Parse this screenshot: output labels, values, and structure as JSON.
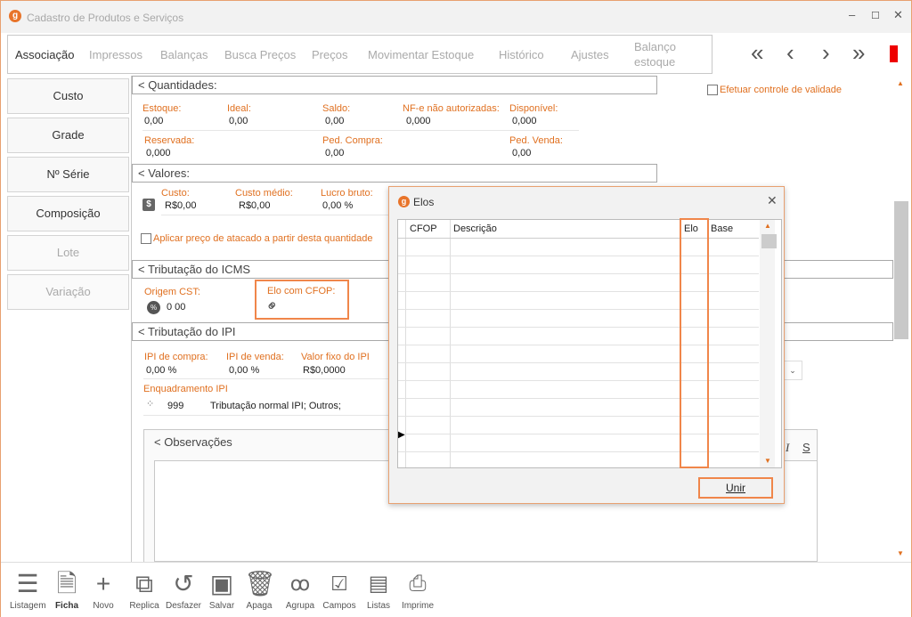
{
  "window": {
    "title": "Cadastro de Produtos e Serviços",
    "min": "–",
    "max": "☐",
    "close": "✕"
  },
  "tabs": [
    {
      "label": "Associação"
    },
    {
      "label": "Impressos"
    },
    {
      "label": "Balanças"
    },
    {
      "label": "Busca Preços"
    },
    {
      "label": "Preços"
    },
    {
      "label": "Movimentar Estoque"
    },
    {
      "label": "Histórico"
    },
    {
      "label": "Ajustes"
    },
    {
      "label": "Balanço estoque"
    }
  ],
  "nav": {
    "first": "«",
    "prev": "‹",
    "next": "›",
    "last": "»"
  },
  "sidebar": [
    {
      "label": "Custo"
    },
    {
      "label": "Grade"
    },
    {
      "label": "Nº Série"
    },
    {
      "label": "Composição"
    },
    {
      "label": "Lote"
    },
    {
      "label": "Variação"
    }
  ],
  "validade_label": "Efetuar controle de validade",
  "quantidades": {
    "title": "Quantidades:",
    "estoque_label": "Estoque:",
    "estoque": "0,00",
    "ideal_label": "Ideal:",
    "ideal": "0,00",
    "saldo_label": "Saldo:",
    "saldo": "0,00",
    "nfe_label": "NF-e não autorizadas:",
    "nfe": "0,000",
    "disponivel_label": "Disponível:",
    "disponivel": "0,000",
    "reservada_label": "Reservada:",
    "reservada": "0,000",
    "pedcompra_label": "Ped. Compra:",
    "pedcompra": "0,00",
    "pedvenda_label": "Ped. Venda:",
    "pedvenda": "0,00"
  },
  "valores": {
    "title": "Valores:",
    "custo_label": "Custo:",
    "custo": "R$0,00",
    "customedio_label": "Custo médio:",
    "customedio": "R$0,00",
    "lucro_label": "Lucro bruto:",
    "lucro": "0,00 %",
    "atacado_label": "Aplicar preço de atacado a partir desta quantidade"
  },
  "icms": {
    "title": "Tributação do ICMS",
    "origem_label": "Origem CST:",
    "origem": "0 00",
    "elo_label": "Elo com CFOP:"
  },
  "ipi": {
    "title": "Tributação do IPI",
    "compra_label": "IPI de compra:",
    "compra": "0,00 %",
    "venda_label": "IPI de venda:",
    "venda": "0,00 %",
    "fixo_label": "Valor fixo do IPI",
    "fixo": "R$0,0000",
    "enq_label": "Enquadramento IPI",
    "enq_code": "999",
    "enq_desc": "Tributação normal IPI; Outros;"
  },
  "observacoes": {
    "title": "Observações",
    "italic": "I",
    "strike": "S"
  },
  "dialog": {
    "title": "Elos",
    "close": "✕",
    "columns": [
      "CFOP",
      "Descrição",
      "Elo",
      "Base"
    ],
    "button": "Unir"
  },
  "toolbar": [
    {
      "label": "Listagem",
      "icon": "list-icon"
    },
    {
      "label": "Ficha",
      "icon": "form-icon"
    },
    {
      "label": "Novo",
      "icon": "plus-icon"
    },
    {
      "label": "Replica",
      "icon": "copy-icon"
    },
    {
      "label": "Desfazer",
      "icon": "undo-icon"
    },
    {
      "label": "Salvar",
      "icon": "save-icon"
    },
    {
      "label": "Apaga",
      "icon": "trash-icon"
    },
    {
      "label": "Agrupa",
      "icon": "group-icon"
    },
    {
      "label": "Campos",
      "icon": "checklist-icon"
    },
    {
      "label": "Listas",
      "icon": "lists-icon"
    },
    {
      "label": "Imprime",
      "icon": "printer-icon"
    }
  ]
}
